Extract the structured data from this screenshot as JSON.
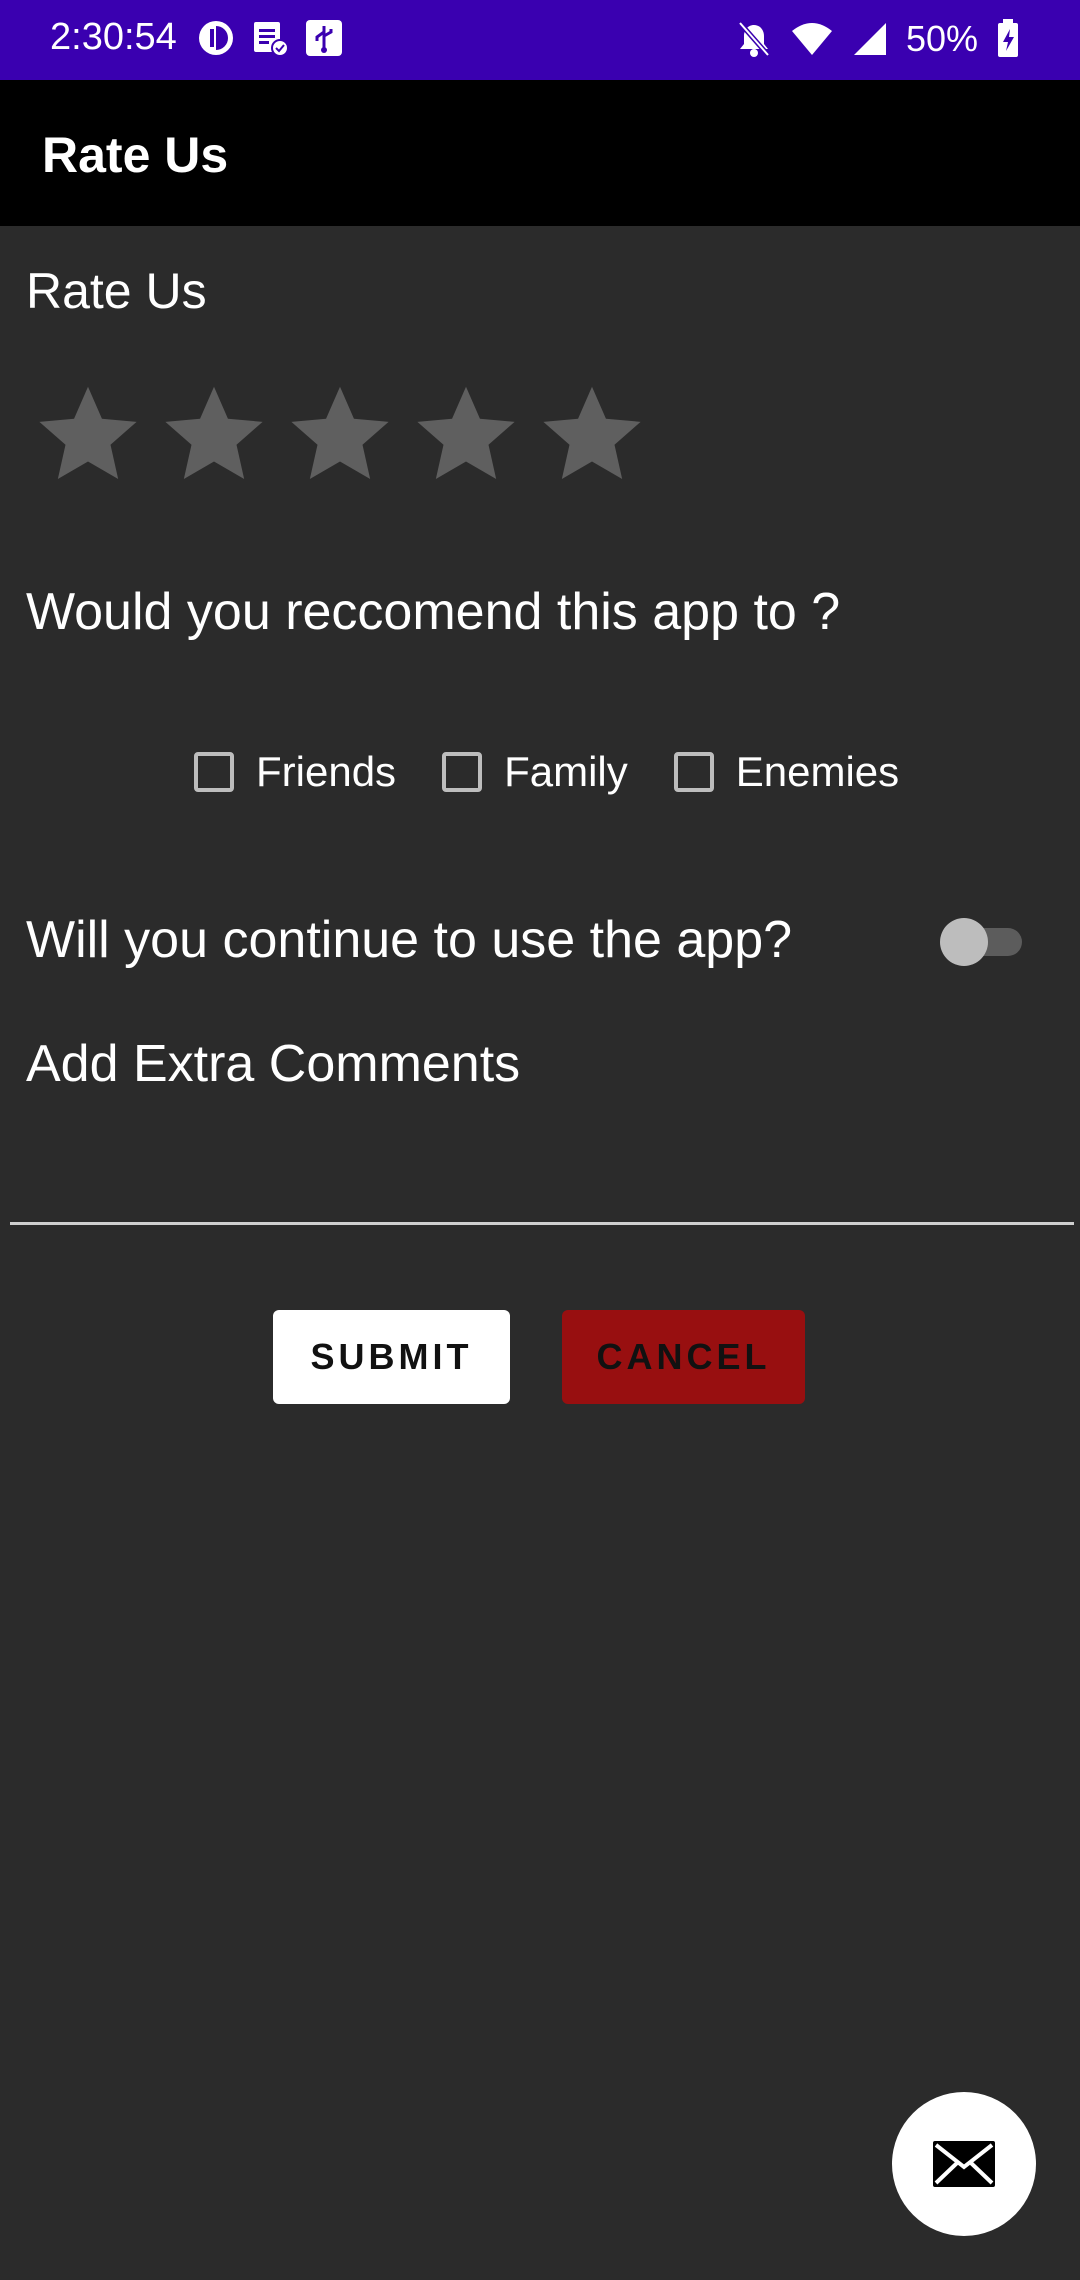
{
  "status_bar": {
    "time": "2:30:54",
    "battery": "50%",
    "icons_left": [
      "data-saver-icon",
      "task-list-icon",
      "usb-icon"
    ],
    "icons_right": [
      "notifications-off-icon",
      "wifi-icon",
      "signal-icon",
      "battery-charging-icon"
    ],
    "color": "#3a00b0"
  },
  "toolbar": {
    "title": "Rate Us"
  },
  "rating": {
    "label": "Rate Us",
    "stars_total": 5,
    "stars_filled": 0
  },
  "recommend": {
    "question": "Would you reccomend this app to ?",
    "options": [
      {
        "label": "Friends",
        "checked": false
      },
      {
        "label": "Family",
        "checked": false
      },
      {
        "label": "Enemies",
        "checked": false
      }
    ]
  },
  "continue_use": {
    "question": "Will you continue to use the app?",
    "switch_on": false
  },
  "comments": {
    "label": "Add Extra Comments",
    "value": ""
  },
  "buttons": {
    "submit": "SUBMIT",
    "cancel": "CANCEL",
    "cancel_color": "#980f10"
  },
  "fab": {
    "icon": "mail-icon"
  }
}
